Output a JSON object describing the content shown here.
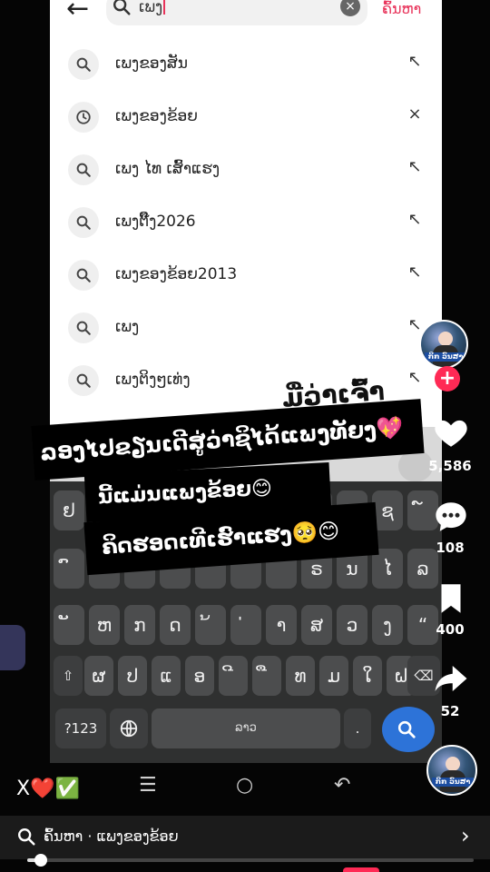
{
  "search": {
    "query": "ເພງ",
    "button_label": "ຄົ້ນຫາ"
  },
  "suggestions": [
    {
      "text": "ເພງຂອງສັນ",
      "icon": "search-icon",
      "action": "arrow-up-left-icon"
    },
    {
      "text": "ເພງຂອງຂ້ອຍ",
      "icon": "clock-icon",
      "action": "close-icon"
    },
    {
      "text": "ເພງ ໄທ ເສົ້າແຮງ",
      "icon": "search-icon",
      "action": "arrow-up-left-icon"
    },
    {
      "text": "ເພງຕິ໊ງ2026",
      "icon": "search-icon",
      "action": "arrow-up-left-icon"
    },
    {
      "text": "ເພງຂອງຂ້ອຍ2013",
      "icon": "search-icon",
      "action": "arrow-up-left-icon"
    },
    {
      "text": "ເພງ",
      "icon": "search-icon",
      "action": "arrow-up-left-icon"
    },
    {
      "text": "ເພງຕິງໆເທ່ງ",
      "icon": "search-icon",
      "action": "arrow-up-left-icon"
    }
  ],
  "background_text": "ມື່ວ່າເຈົ້າ",
  "captions": [
    "ລອງໄປຂຽນເດີສູ່ວ່າຊິໄດ້ແພງທັຍງ💖",
    "ນີ້ແມ່ນແພງຂ້ອຍ😊",
    "ຄິດຮອດເທີເຮົາແຮງ🥺😊"
  ],
  "keyboard": {
    "rows": [
      [
        "ຢ",
        "ຟ",
        "",
        "",
        "",
        "",
        "",
        "",
        "",
        "ຊ",
        "໌"
      ],
      [
        "ົ",
        "",
        "",
        "",
        "",
        "",
        "",
        "ຣ",
        "ນ",
        "ໄ",
        "ລ"
      ],
      [
        "ັ",
        "ຫ",
        "ກ",
        "ດ",
        "້",
        "່",
        "າ",
        "ສ",
        "ວ",
        "ງ",
        "“"
      ],
      [
        "ຜ",
        "ປ",
        "ແ",
        "ອ",
        "ີ",
        "ື",
        "ທ",
        "ມ",
        "ໃ",
        "ຝ"
      ]
    ],
    "numbers_label": "?123",
    "space_label": "ລາວ"
  },
  "rail": {
    "likes": "5,586",
    "comments": "108",
    "saves": "400",
    "shares": "52"
  },
  "avatar_tag": "ກິກ ວົນສາ",
  "bottom": {
    "emoji_row": "X❤️✅",
    "search_label": "ຄົ້ນຫາ · ແພງຂອງຂ້ອຍ",
    "progress": 0.03
  },
  "colors": {
    "accent": "#ff2a55",
    "search_button": "#e8335a",
    "go_key": "#2d73d8"
  }
}
